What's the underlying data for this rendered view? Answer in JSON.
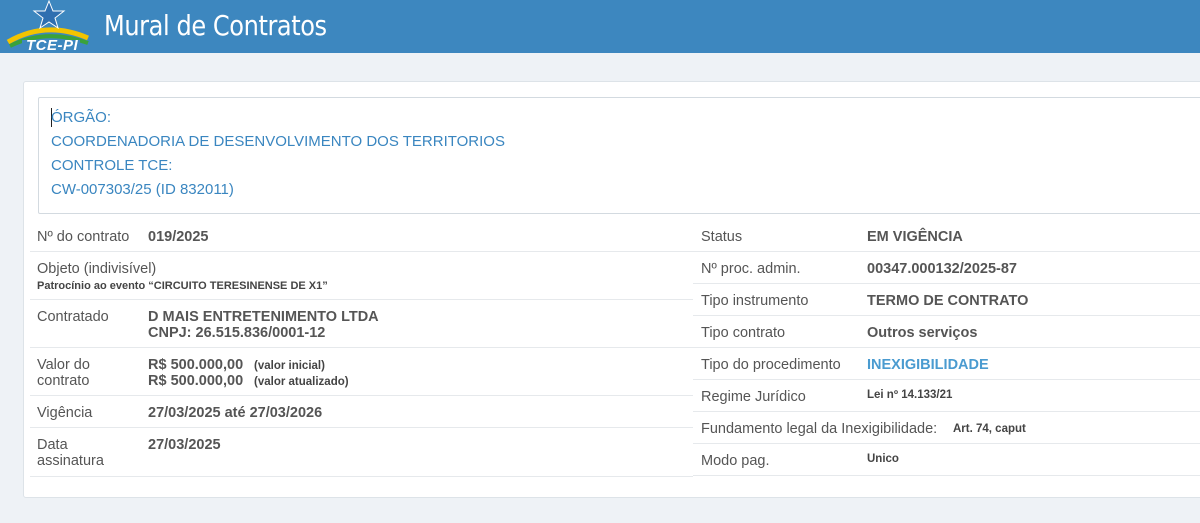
{
  "app": {
    "title": "Mural de Contratos",
    "logo_text": "TCE-PI"
  },
  "header": {
    "orgao_label": "ÓRGÃO:",
    "orgao_value": "COORDENADORIA DE DESENVOLVIMENTO DOS TERRITORIOS",
    "controle_label": "CONTROLE TCE:",
    "controle_value": "CW-007303/25 (ID 832011)"
  },
  "left": {
    "numero": {
      "label": "Nº do contrato",
      "value": "019/2025"
    },
    "objeto": {
      "label": "Objeto (indivisível)",
      "value": "Patrocínio ao evento “CIRCUITO TERESINENSE DE X1”"
    },
    "contratado": {
      "label": "Contratado",
      "name": "D MAIS ENTRETENIMENTO LTDA",
      "cnpj": "CNPJ: 26.515.836/0001-12"
    },
    "valor": {
      "label_1": "Valor do",
      "label_2": "contrato",
      "inicial": "R$ 500.000,00",
      "inicial_note": "(valor inicial)",
      "atualizado": "R$ 500.000,00",
      "atualizado_note": "(valor atualizado)"
    },
    "vigencia": {
      "label": "Vigência",
      "value": "27/03/2025 até 27/03/2026"
    },
    "assinatura": {
      "label_1": "Data",
      "label_2": "assinatura",
      "value": "27/03/2025"
    }
  },
  "right": {
    "status": {
      "label": "Status",
      "value": "EM VIGÊNCIA"
    },
    "proc": {
      "label": "Nº proc. admin.",
      "value": "00347.000132/2025-87"
    },
    "tipo_instrumento": {
      "label": "Tipo instrumento",
      "value": "TERMO DE CONTRATO"
    },
    "tipo_contrato": {
      "label": "Tipo contrato",
      "value": "Outros serviços"
    },
    "tipo_procedimento": {
      "label": "Tipo do procedimento",
      "value": "INEXIGIBILIDADE"
    },
    "regime": {
      "label": "Regime Jurídico",
      "value": "Lei nº 14.133/21"
    },
    "fundamento": {
      "label": "Fundamento legal da Inexigibilidade:",
      "value": "Art. 74, caput"
    },
    "modo_pag": {
      "label": "Modo pag.",
      "value": "Unico"
    }
  },
  "colors": {
    "topbar": "#3d87bf",
    "link_blue": "#3a86c0",
    "highlight_blue": "#4a9bd0",
    "star": "#2f6fb0"
  }
}
